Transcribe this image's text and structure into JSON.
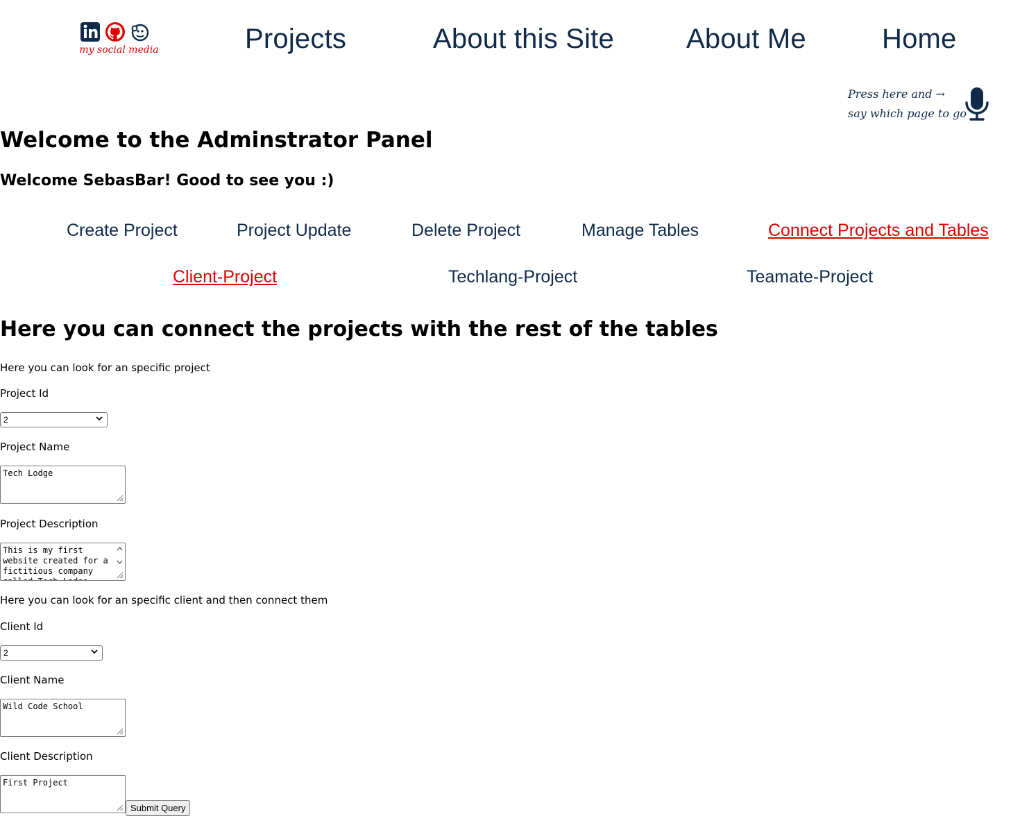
{
  "header": {
    "social": {
      "icons": [
        "linkedin-icon",
        "github-icon",
        "mailchimp-icon"
      ],
      "caption": "my social media"
    },
    "nav": [
      "Projects",
      "About this Site",
      "About Me",
      "Home"
    ]
  },
  "voice": {
    "line1": "Press here and →",
    "line2": "say which page to go",
    "icon": "microphone-icon"
  },
  "main": {
    "title": "Welcome to the Adminstrator Panel",
    "welcome": "Welcome SebasBar! Good to see you :)",
    "admin_nav": [
      "Create Project",
      "Project Update",
      "Delete Project",
      "Manage Tables",
      "Connect Projects and Tables"
    ],
    "connect_nav": [
      "Client-Project",
      "Techlang-Project",
      "Teamate-Project"
    ],
    "section_title": "Here you can connect the projects with the rest of the tables"
  },
  "form": {
    "project_intro": "Here you can look for an specific project",
    "project_id_label": "Project Id",
    "project_id_value": "2",
    "project_name_label": "Project Name",
    "project_name_value": "Tech Lodge",
    "project_desc_label": "Project Description",
    "project_desc_value": "This is my first website created for a fictitious company called Tech Lodge",
    "client_intro": "Here you can look for an specific client and then connect them",
    "client_id_label": "Client Id",
    "client_id_value": "2",
    "client_name_label": "Client Name",
    "client_name_value": "Wild Code School",
    "client_desc_label": "Client Description",
    "client_desc_value": "First Project",
    "submit_label": "Submit Query"
  },
  "colors": {
    "nav_text": "#0f2a4a",
    "active_link": "#e00000",
    "github_red": "#e00000"
  }
}
